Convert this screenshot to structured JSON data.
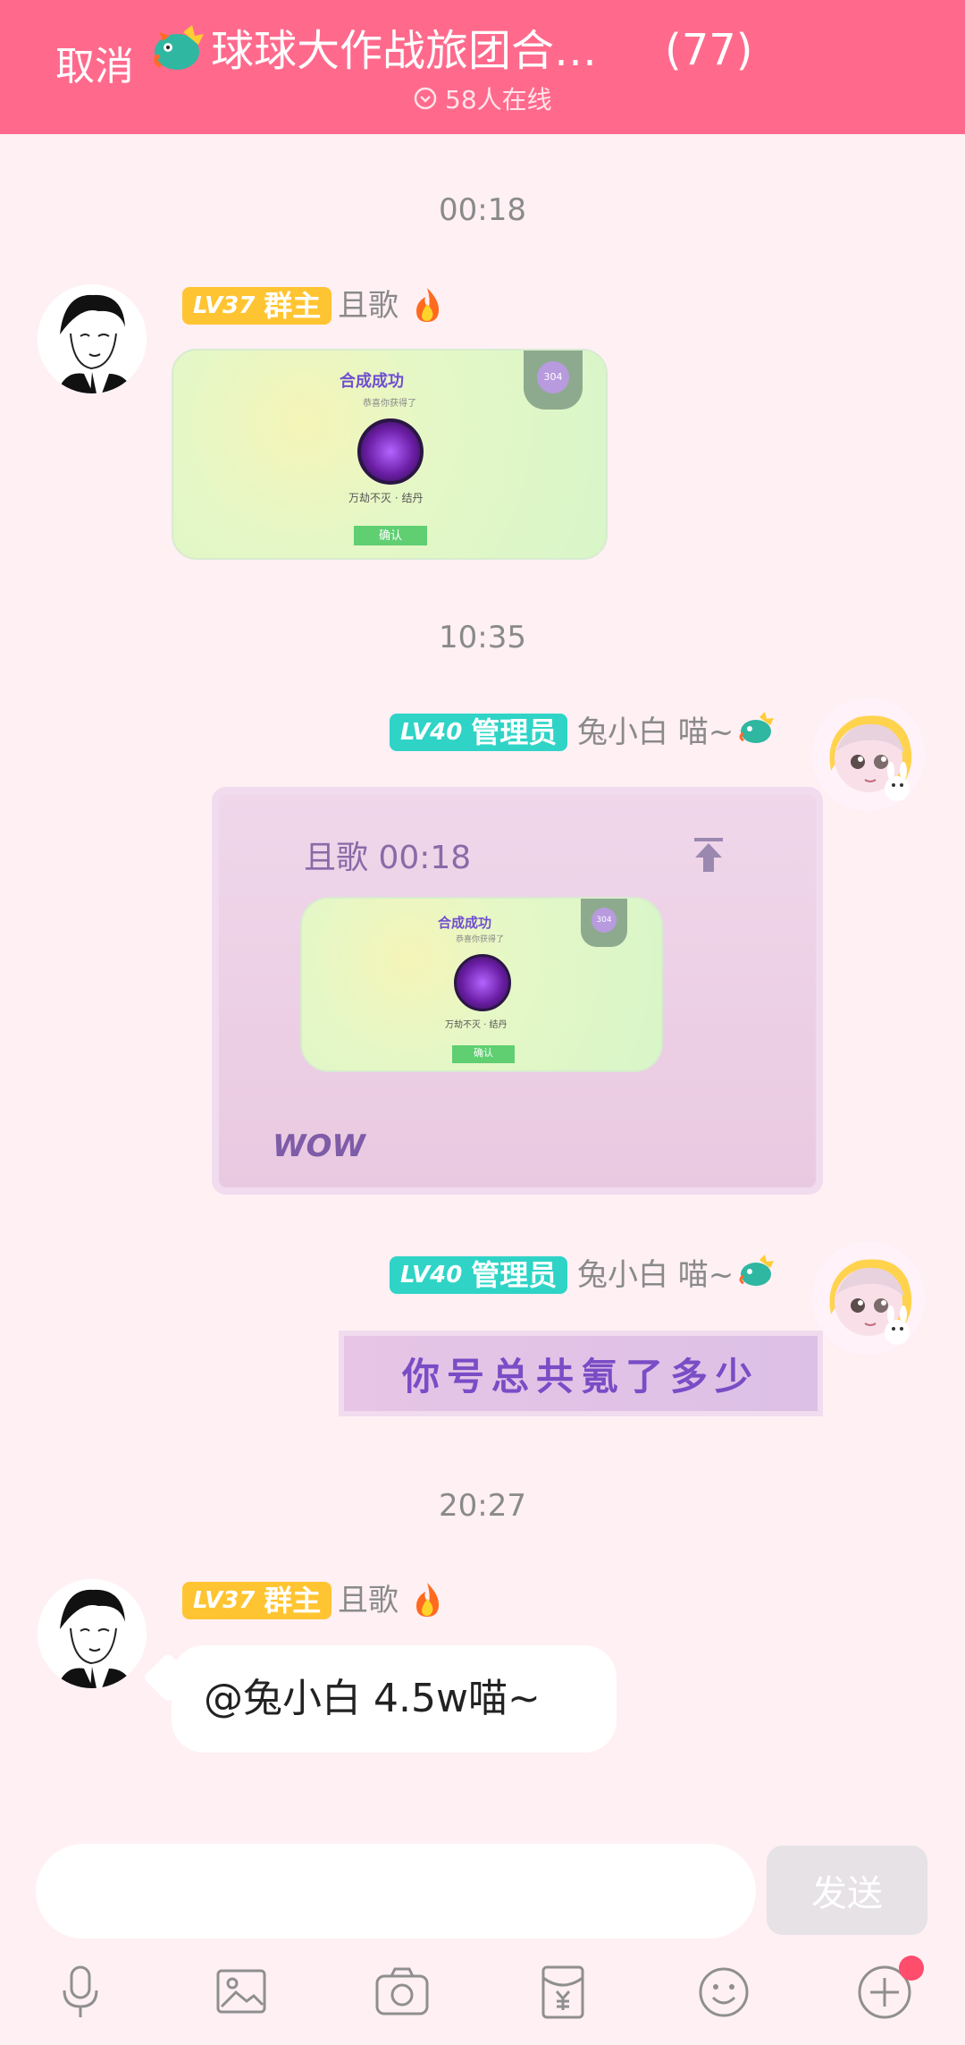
{
  "header": {
    "cancel_label": "取消",
    "title": "球球大作战旅团合…",
    "member_count": "(77)",
    "online_text": "58人在线"
  },
  "messages": [
    {
      "time": "00:18",
      "level": "LV37",
      "role": "群主",
      "nickname": "且歌",
      "card": {
        "title": "合成成功",
        "subtitle": "恭喜你获得了",
        "item": "万劫不灭 · 结丹",
        "badge_value": "304",
        "button": "确认"
      }
    },
    {
      "time": "10:35",
      "level": "LV40",
      "role": "管理员",
      "nickname": "兔小白 喵~",
      "quote_header": "且歌 00:18",
      "quote_caption": "WOW",
      "card": {
        "title": "合成成功",
        "subtitle": "恭喜你获得了",
        "item": "万劫不灭 · 结丹",
        "badge_value": "304",
        "button": "确认"
      }
    },
    {
      "level": "LV40",
      "role": "管理员",
      "nickname": "兔小白 喵~",
      "text": "你号总共氪了多少"
    },
    {
      "time": "20:27",
      "level": "LV37",
      "role": "群主",
      "nickname": "且歌",
      "text": "@兔小白  4.5w喵~"
    }
  ],
  "composer": {
    "input_placeholder": "",
    "send_label": "发送"
  },
  "toolbar": [
    {
      "icon": "microphone-icon"
    },
    {
      "icon": "image-icon"
    },
    {
      "icon": "camera-icon"
    },
    {
      "icon": "red-envelope-icon"
    },
    {
      "icon": "emoji-icon"
    },
    {
      "icon": "plus-icon"
    }
  ],
  "colors": {
    "header": "#ff6a8c",
    "background": "#fff0f4",
    "owner_badge": "#ffc431",
    "admin_badge": "#2fd4c6"
  }
}
